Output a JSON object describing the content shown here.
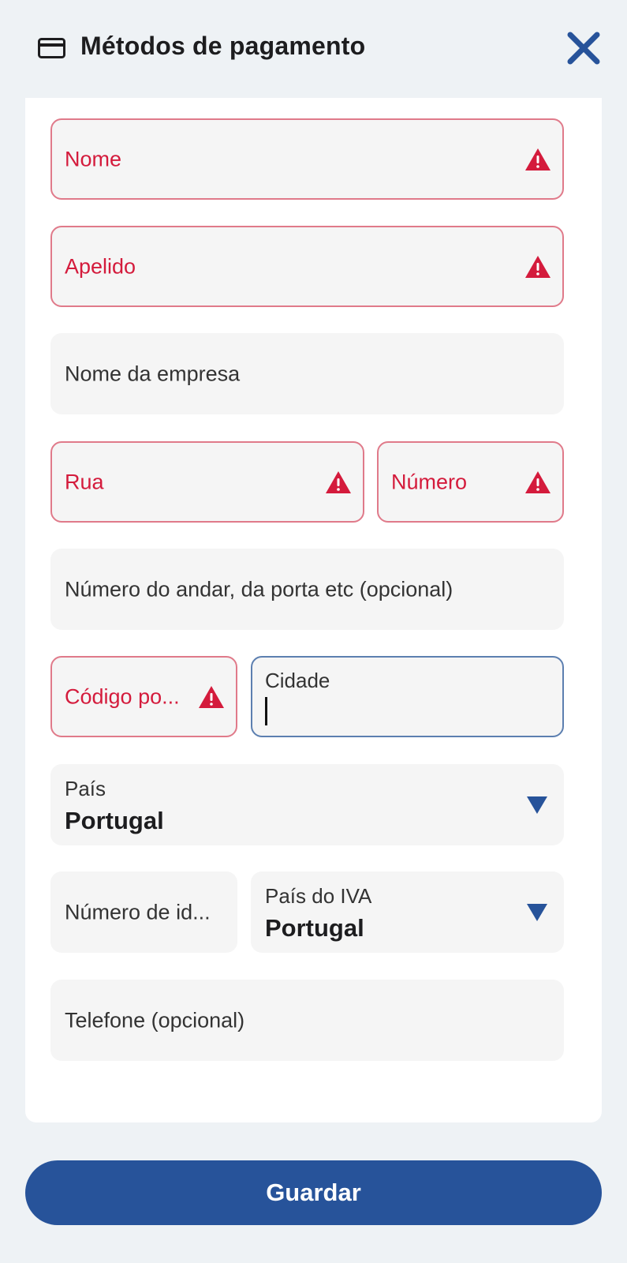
{
  "header": {
    "title": "Métodos de pagamento",
    "icon": "credit-card-icon",
    "close_icon": "close-icon"
  },
  "form": {
    "first_name": {
      "label": "Nome",
      "state": "error"
    },
    "last_name": {
      "label": "Apelido",
      "state": "error"
    },
    "company": {
      "label": "Nome da empresa"
    },
    "street": {
      "label": "Rua",
      "state": "error"
    },
    "number": {
      "label": "Número",
      "state": "error"
    },
    "floor": {
      "label": "Número do andar, da porta etc (opcional)"
    },
    "postal_code": {
      "label": "Código po...",
      "state": "error"
    },
    "city": {
      "label": "Cidade",
      "value": "",
      "state": "focused"
    },
    "country": {
      "label": "País",
      "value": "Portugal"
    },
    "tax_id": {
      "label": "Número de id..."
    },
    "vat_country": {
      "label": "País do IVA",
      "value": "Portugal"
    },
    "phone": {
      "label": "Telefone (opcional)"
    }
  },
  "actions": {
    "save_label": "Guardar"
  },
  "colors": {
    "error": "#d41b3c",
    "error_border": "#e07a8a",
    "accent": "#27539a",
    "focus_border": "#5c7fb0",
    "background": "#eef2f5"
  }
}
